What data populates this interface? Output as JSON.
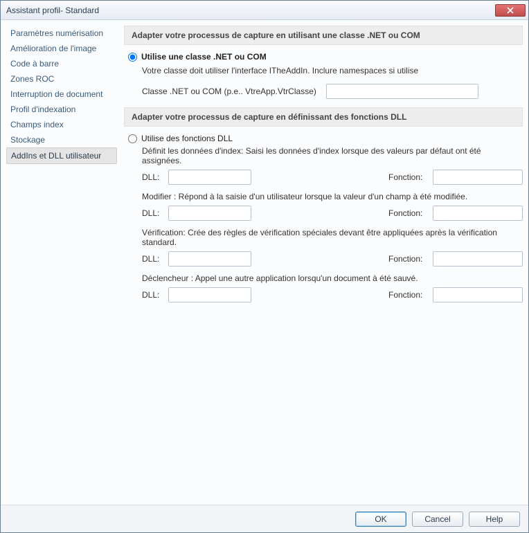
{
  "window": {
    "title": "Assistant profil- Standard"
  },
  "sidebar": {
    "items": [
      {
        "label": "Paramètres numérisation",
        "selected": false
      },
      {
        "label": "Amélioration de l'image",
        "selected": false
      },
      {
        "label": "Code à barre",
        "selected": false
      },
      {
        "label": "Zones ROC",
        "selected": false
      },
      {
        "label": "Interruption de document",
        "selected": false
      },
      {
        "label": "Profil d'indexation",
        "selected": false
      },
      {
        "label": "Champs index",
        "selected": false
      },
      {
        "label": "Stockage",
        "selected": false
      },
      {
        "label": "AddIns et DLL utilisateur",
        "selected": true
      }
    ]
  },
  "section_net": {
    "header": "Adapter votre processus de capture en utilisant une classe .NET ou COM",
    "radio_label": "Utilise une classe .NET ou COM",
    "radio_checked": true,
    "description": "Votre classe doit utiliser l'interface ITheAddIn. Inclure namespaces si utilise",
    "class_label": "Classe .NET ou COM  (p.e.. VtreApp.VtrClasse)",
    "class_value": ""
  },
  "section_dll": {
    "header": "Adapter votre processus de capture en définissant des fonctions DLL",
    "radio_label": "Utilise des fonctions DLL",
    "radio_checked": false,
    "groups": [
      {
        "desc": "Définit les données d'index: Saisi les données d'index lorsque des valeurs par défaut ont été assignées.",
        "dll_label": "DLL:",
        "dll_value": "",
        "fn_label": "Fonction:",
        "fn_value": ""
      },
      {
        "desc": "Modifier : Répond à la saisie d'un utilisateur lorsque la valeur d'un champ à été modifiée.",
        "dll_label": "DLL:",
        "dll_value": "",
        "fn_label": "Fonction:",
        "fn_value": ""
      },
      {
        "desc": "Vérification: Crée des règles de vérification spéciales devant être appliquées après la vérification standard.",
        "dll_label": "DLL:",
        "dll_value": "",
        "fn_label": "Fonction:",
        "fn_value": ""
      },
      {
        "desc": "Déclencheur : Appel une autre application lorsqu'un document à été sauvé.",
        "dll_label": "DLL:",
        "dll_value": "",
        "fn_label": "Fonction:",
        "fn_value": ""
      }
    ]
  },
  "footer": {
    "ok": "OK",
    "cancel": "Cancel",
    "help": "Help"
  }
}
